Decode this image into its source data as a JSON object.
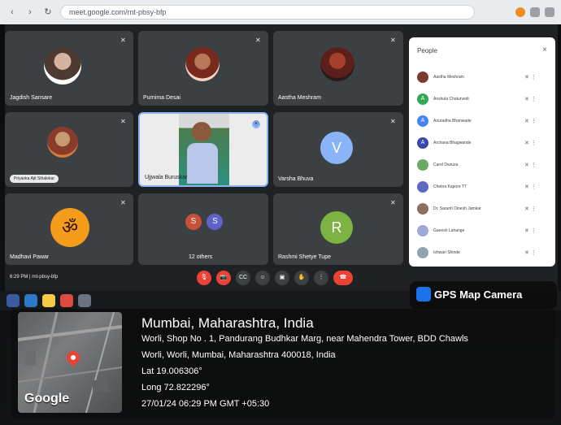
{
  "browser": {
    "url": "meet.google.com/rnt-pbsy-bfp"
  },
  "tiles": {
    "t1": {
      "name": "Jagdish Sansare"
    },
    "t2": {
      "name": "Purnima Desai"
    },
    "t3": {
      "name": "Aastha Meshram"
    },
    "t4": {
      "chip": "Priyanka Ajit Sthalekar"
    },
    "t5": {
      "name": "Ujjwala Buruskar"
    },
    "t6": {
      "name": "Varsha Bhuva",
      "letter": "V"
    },
    "t7": {
      "name": "Madhavi Pawar"
    },
    "t8": {
      "letters": [
        "S",
        "S"
      ],
      "name": "12 others"
    },
    "t9": {
      "name": "Rashmi Shetye Tupe",
      "letter": "R"
    }
  },
  "people": {
    "title": "People",
    "close": "×",
    "items": [
      {
        "name": "Aastha Meshram",
        "avatar_color": "#7a3b2e"
      },
      {
        "name": "Anshula Chaturvedi",
        "avatar_color": "#34a853",
        "initial": "A"
      },
      {
        "name": "Anuradha Bhanwade",
        "avatar_color": "#4285f4",
        "initial": "A"
      },
      {
        "name": "Archana Bhagwande",
        "avatar_color": "#3949ab",
        "initial": "A"
      },
      {
        "name": "Carol Dsouza",
        "avatar_color": "#6aaa64"
      },
      {
        "name": "Chetna Kapore TT",
        "avatar_color": "#5c6bc0"
      },
      {
        "name": "Dr. Saranh Dinesh Jamkar",
        "avatar_color": "#8d6e63"
      },
      {
        "name": "Ganesh Lahange",
        "avatar_color": "#9fa8da"
      },
      {
        "name": "Ishwari Shinde",
        "avatar_color": "#90a4ae"
      }
    ]
  },
  "meet_status": {
    "time": "6:29 PM",
    "separator": "|",
    "meeting_code": "rnt-pbsy-bfp"
  },
  "gps": {
    "brand": "GPS Map Camera",
    "city": "Mumbai, Maharashtra, India",
    "address1": "Worli, Shop No . 1, Pandurang Budhkar Marg, near Mahendra Tower, BDD Chawls",
    "address2": "Worli, Worli, Mumbai, Maharashtra 400018, India",
    "lat": "Lat 19.006306°",
    "long": "Long 72.822296°",
    "timestamp": "27/01/24 06:29 PM GMT +05:30",
    "map_label": "Google"
  },
  "colors": {
    "tile": "#3c4043",
    "background": "#202124",
    "accent": "#8ab4f8",
    "red": "#ea4335",
    "green": "#34a853"
  }
}
